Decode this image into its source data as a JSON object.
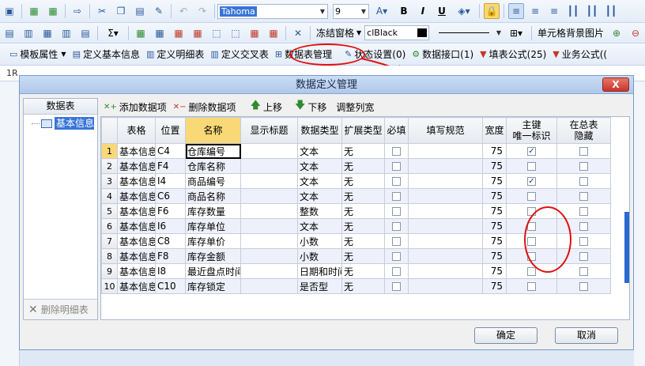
{
  "toolbar1": {
    "font_name": "Tahoma",
    "font_size": "9",
    "bold": "B",
    "italic": "I",
    "underline": "U"
  },
  "toolbar2": {
    "sigma": "Σ",
    "freeze_panes": "冻结窗格",
    "color_name": "clBlack",
    "cell_bg_image": "单元格背景图片"
  },
  "toolbar3": {
    "template_props": "模板属性",
    "define_basic_info": "定义基本信息",
    "define_detail_table": "定义明细表",
    "define_cross_table": "定义交叉表",
    "data_table_manage": "数据表管理",
    "status_settings": "状态设置(0)",
    "data_interface": "数据接口(1)",
    "fill_formula": "填表公式(25)",
    "business_formula": "业务公式(("
  },
  "background": {
    "cell_ref": "1R"
  },
  "dialog": {
    "title": "数据定义管理",
    "close": "X",
    "left_panel": {
      "header": "数据表",
      "tree_item": "基本信息",
      "delete_detail": "删除明细表"
    },
    "toolbar": {
      "add_item": "添加数据项",
      "delete_item": "删除数据项",
      "move_up": "上移",
      "move_down": "下移",
      "adjust_width": "调整列宽"
    },
    "columns": [
      "表格",
      "位置",
      "名称",
      "显示标题",
      "数据类型",
      "扩展类型",
      "必填",
      "填写规范",
      "宽度",
      "主键\n唯一标识",
      "在总表\n隐藏"
    ],
    "rows": [
      {
        "n": "1",
        "table": "基本信息",
        "pos": "C4",
        "name": "仓库编号",
        "title": "",
        "type": "文本",
        "ext": "无",
        "req": false,
        "rule": "",
        "width": "75",
        "pk": true,
        "hide": false
      },
      {
        "n": "2",
        "table": "基本信息",
        "pos": "F4",
        "name": "仓库名称",
        "title": "",
        "type": "文本",
        "ext": "无",
        "req": false,
        "rule": "",
        "width": "75",
        "pk": false,
        "hide": false
      },
      {
        "n": "3",
        "table": "基本信息",
        "pos": "I4",
        "name": "商品编号",
        "title": "",
        "type": "文本",
        "ext": "无",
        "req": false,
        "rule": "",
        "width": "75",
        "pk": true,
        "hide": false
      },
      {
        "n": "4",
        "table": "基本信息",
        "pos": "C6",
        "name": "商品名称",
        "title": "",
        "type": "文本",
        "ext": "无",
        "req": false,
        "rule": "",
        "width": "75",
        "pk": false,
        "hide": false
      },
      {
        "n": "5",
        "table": "基本信息",
        "pos": "F6",
        "name": "库存数量",
        "title": "",
        "type": "整数",
        "ext": "无",
        "req": false,
        "rule": "",
        "width": "75",
        "pk": false,
        "hide": false
      },
      {
        "n": "6",
        "table": "基本信息",
        "pos": "I6",
        "name": "库存单位",
        "title": "",
        "type": "文本",
        "ext": "无",
        "req": false,
        "rule": "",
        "width": "75",
        "pk": false,
        "hide": false
      },
      {
        "n": "7",
        "table": "基本信息",
        "pos": "C8",
        "name": "库存单价",
        "title": "",
        "type": "小数",
        "ext": "无",
        "req": false,
        "rule": "",
        "width": "75",
        "pk": false,
        "hide": false
      },
      {
        "n": "8",
        "table": "基本信息",
        "pos": "F8",
        "name": "库存金额",
        "title": "",
        "type": "小数",
        "ext": "无",
        "req": false,
        "rule": "",
        "width": "75",
        "pk": false,
        "hide": false
      },
      {
        "n": "9",
        "table": "基本信息",
        "pos": "I8",
        "name": "最近盘点时间",
        "title": "",
        "type": "日期和时间",
        "ext": "无",
        "req": false,
        "rule": "",
        "width": "75",
        "pk": false,
        "hide": false
      },
      {
        "n": "10",
        "table": "基本信息",
        "pos": "C10",
        "name": "库存锁定",
        "title": "",
        "type": "是否型",
        "ext": "无",
        "req": false,
        "rule": "",
        "width": "75",
        "pk": false,
        "hide": false
      }
    ],
    "ok": "确定",
    "cancel": "取消"
  },
  "colors": {
    "title_bar": "#b0c9ea",
    "highlight_oval": "#e01010",
    "active_header": "#f9d877",
    "tree_selected": "#3875d7"
  }
}
